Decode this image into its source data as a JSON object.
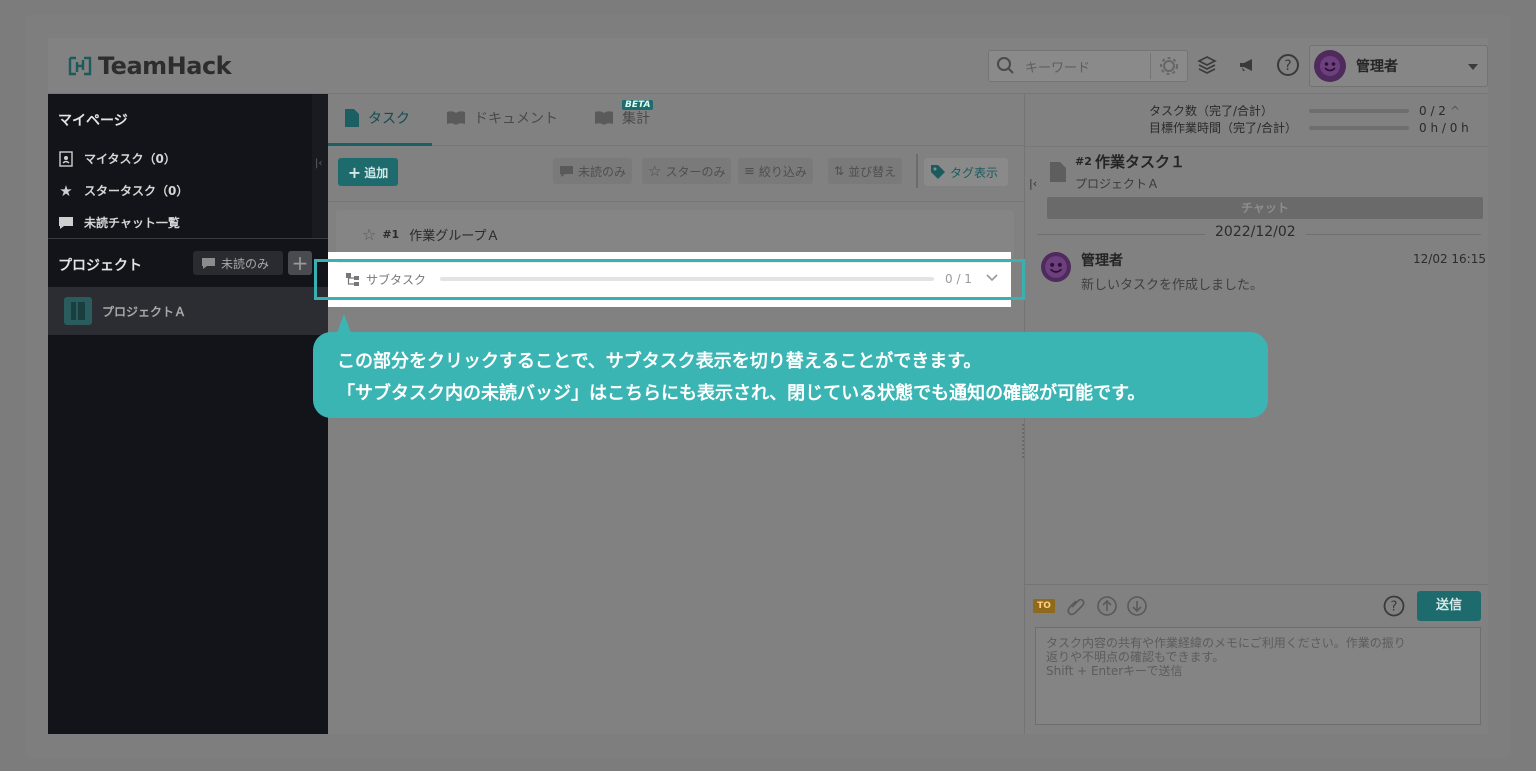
{
  "app": {
    "logo_text": "TeamHack"
  },
  "header": {
    "search_placeholder": "キーワード",
    "user_name": "管理者"
  },
  "sidebar": {
    "mypage_title": "マイページ",
    "items": [
      {
        "label": "マイタスク（0）",
        "icon": "document-user-icon"
      },
      {
        "label": "スタータスク（0）",
        "icon": "star-icon"
      },
      {
        "label": "未読チャット一覧",
        "icon": "chat-bubble-icon"
      }
    ],
    "projects_title": "プロジェクト",
    "unread_only_label": "未読のみ",
    "add_label": "+",
    "projects": [
      {
        "name": "プロジェクトＡ"
      }
    ]
  },
  "tabs": [
    {
      "label": "タスク",
      "active": true
    },
    {
      "label": "ドキュメント",
      "active": false
    },
    {
      "label": "集計",
      "active": false,
      "badge": "BETA"
    }
  ],
  "toolbar": {
    "add_label": "追加",
    "unread_only": "未読のみ",
    "star_only": "スターのみ",
    "filter": "絞り込み",
    "sort": "並び替え",
    "tag_display": "タグ表示"
  },
  "task_list": {
    "group": {
      "number": "#1",
      "name": "作業グループＡ"
    },
    "subtask": {
      "label": "サブタスク",
      "count": "0 / 1",
      "progress": 0
    }
  },
  "callout": {
    "line1": "この部分をクリックすることで、サブタスク表示を切り替えることができます。",
    "line2": "「サブタスク内の未読バッジ」はこちらにも表示され、閉じている状態でも通知の確認が可能です。"
  },
  "stats": {
    "task_count_label": "タスク数（完了/合計）",
    "task_count_value": "0 / 2",
    "task_count_extra": "^",
    "work_time_label": "目標作業時間（完了/合計）",
    "work_time_value": "0 h / 0 h"
  },
  "task_detail": {
    "number": "#2",
    "title": "作業タスク１",
    "project": "プロジェクトＡ",
    "chat_tab": "チャット",
    "date": "2022/12/02",
    "message": {
      "author": "管理者",
      "time": "12/02 16:15",
      "text": "新しいタスクを作成しました。"
    }
  },
  "composer": {
    "to_label": "TO",
    "send_label": "送信",
    "placeholder_line1": "タスク内容の共有や作業経緯のメモにご利用ください。作業の振り",
    "placeholder_line2": "返りや不明点の確認もできます。",
    "placeholder_line3": "Shift + Enterキーで送信"
  },
  "colors": {
    "accent": "#3bb5b4",
    "sidebar_bg": "#131419",
    "primary_button": "#1e6b6e"
  }
}
